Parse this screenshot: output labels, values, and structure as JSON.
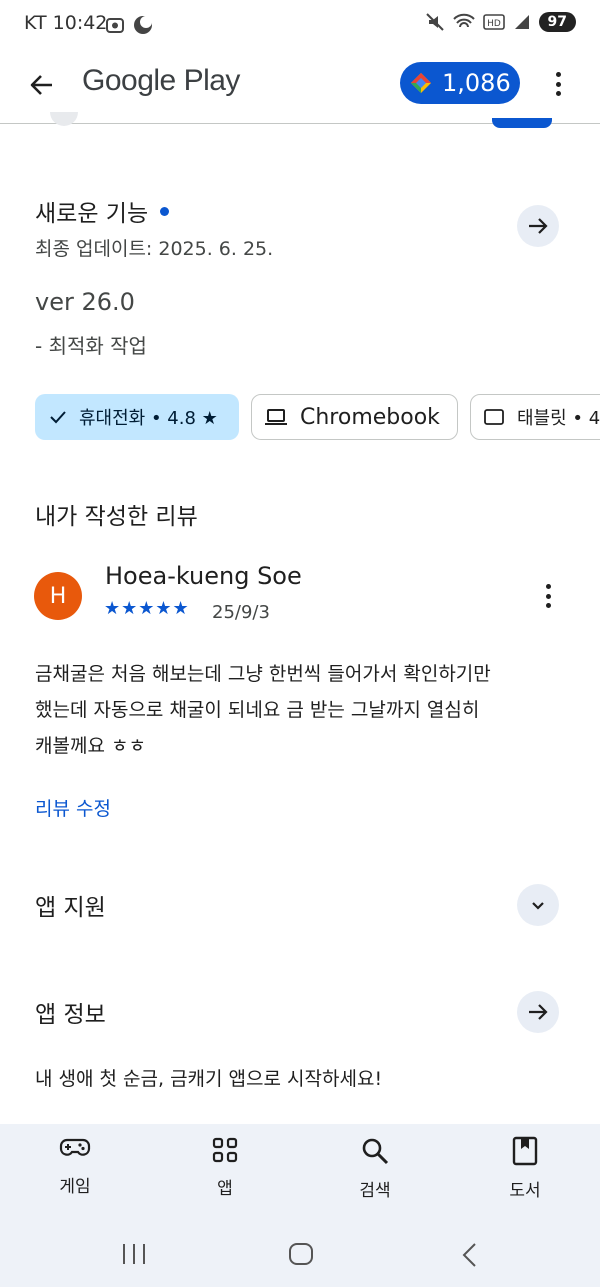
{
  "status_bar": {
    "carrier": "KT",
    "time": "10:42",
    "battery": "97"
  },
  "app_bar": {
    "title": "Google Play",
    "points": "1,086"
  },
  "whats_new": {
    "title": "새로운 기능",
    "updated": "최종 업데이트: 2025. 6. 25.",
    "version": "ver 26.0",
    "notes": "- 최적화 작업"
  },
  "device_chips": [
    {
      "label": "휴대전화 • 4.8 ★",
      "selected": true,
      "icon": "check-icon"
    },
    {
      "label": "Chromebook",
      "selected": false,
      "icon": "laptop-icon"
    },
    {
      "label": "태블릿 • 4.",
      "selected": false,
      "icon": "tablet-icon"
    }
  ],
  "my_review": {
    "section_title": "내가 작성한 리뷰",
    "avatar_letter": "H",
    "reviewer": "Hoea-kueng Soe",
    "stars": "★★★★★",
    "rating": 5,
    "date": "25/9/3",
    "body_lines": [
      "금채굴은 처음 해보는데 그냥 한번씩 들어가서 확인하기만",
      "했는데 자동으로 채굴이 되네요 금 받는 그날까지 열심히",
      "캐볼께요 ㅎㅎ"
    ],
    "edit_label": "리뷰 수정"
  },
  "app_support": {
    "title": "앱 지원"
  },
  "app_info": {
    "title": "앱 정보",
    "description": "내 생애 첫 순금, 금캐기 앱으로 시작하세요!"
  },
  "bottom_nav": [
    {
      "label": "게임",
      "icon": "gamepad-icon"
    },
    {
      "label": "앱",
      "icon": "apps-grid-icon"
    },
    {
      "label": "검색",
      "icon": "search-icon"
    },
    {
      "label": "도서",
      "icon": "book-icon"
    }
  ],
  "colors": {
    "accent": "#0b57d0",
    "chip_selected": "#c2e7ff",
    "avatar": "#e8590c",
    "nav_bg": "#eef2f8"
  }
}
